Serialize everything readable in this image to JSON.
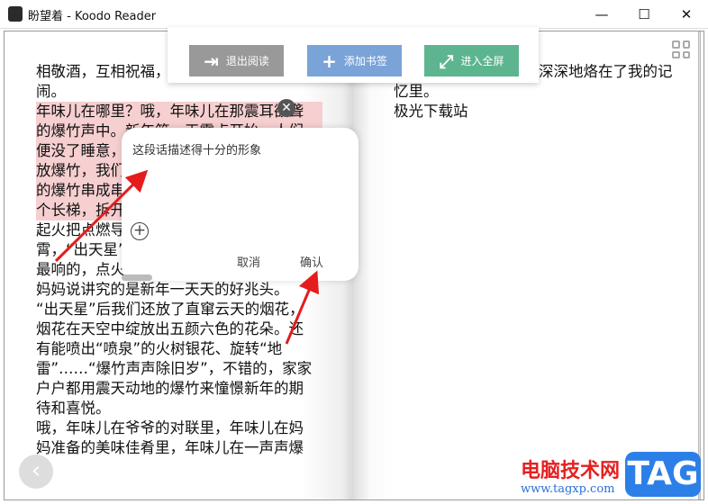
{
  "window": {
    "title": "盼望着 - Koodo Reader",
    "minimize": "—",
    "maximize": "☐",
    "close": "✕"
  },
  "toolbar": {
    "exit": "退出阅读",
    "bookmark": "添加书签",
    "fullscreen": "进入全屏",
    "colors": {
      "exit": "#999999",
      "bookmark": "#7aa3d8",
      "fullscreen": "#5cb58f"
    }
  },
  "left_page": {
    "lines": [
      {
        "text": "相敬酒，互相祝福，",
        "hl": false
      },
      {
        "text": "闹。",
        "hl": false
      },
      {
        "text": "年味儿在哪里？哦，年味儿在那震耳欲聋",
        "hl": true
      },
      {
        "text": "的爆竹声中。新年第一天零点开始，人们",
        "hl": true
      },
      {
        "text": "便没了睡意，",
        "hl": true
      },
      {
        "text": "放爆竹，我们",
        "hl": true
      },
      {
        "text": "的爆竹串成串",
        "hl": true
      },
      {
        "text": "个长梯，拆开",
        "hl": true
      },
      {
        "text": "起火把点燃导",
        "hl": false
      },
      {
        "text": "霄，“出天星”",
        "hl": false
      },
      {
        "text": "最响的，点火",
        "hl": false
      },
      {
        "text": "妈妈说讲究的是新年一天天的好兆头。",
        "hl": false
      },
      {
        "text": "“出天星”后我们还放了直窜云天的烟花，",
        "hl": false
      },
      {
        "text": "烟花在天空中绽放出五颜六色的花朵。还",
        "hl": false
      },
      {
        "text": "有能喷出“喷泉”的火树银花、旋转“地",
        "hl": false
      },
      {
        "text": "雷”……“爆竹声声除旧岁”，不错的，家家",
        "hl": false
      },
      {
        "text": "户户都用震天动地的爆竹来憧憬新年的期",
        "hl": false
      },
      {
        "text": "待和喜悦。",
        "hl": false
      },
      {
        "text": "哦，年味儿在爷爷的对联里，年味儿在妈",
        "hl": false
      },
      {
        "text": "妈准备的美味佳肴里，年味儿在一声声爆",
        "hl": false
      }
    ]
  },
  "right_page": {
    "lines": [
      "深深地烙在了我的记",
      "忆里。",
      "极光下载站"
    ]
  },
  "note_popup": {
    "text": "这段话描述得十分的形象",
    "add": "+",
    "cancel": "取消",
    "confirm": "确认",
    "close": "✕"
  },
  "back_button": "‹",
  "watermark": {
    "site": "电脑技术网",
    "url": "www.tagxp.com",
    "tag": "TAG"
  }
}
